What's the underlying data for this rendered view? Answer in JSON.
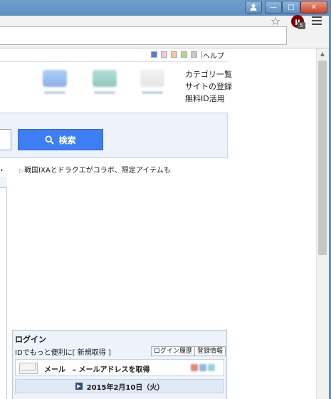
{
  "window": {
    "user_icon": "user-icon",
    "minimize_glyph": "—",
    "maximize_glyph": "□",
    "close_glyph": "✕"
  },
  "toolbar": {
    "bookmark_icon": "☆",
    "extension_label": "μ",
    "extension_badge": "5"
  },
  "header": {
    "color_swatches": [
      "#4a7fd6",
      "#f3c6de",
      "#f7c78e",
      "#a9dd8a",
      "#c9c9c9"
    ],
    "help_link": "ヘルプ",
    "side_links": [
      "カテゴリ一覧",
      "サイトの登録",
      "無料ID活用"
    ]
  },
  "search": {
    "button_label": "検索",
    "icon": "search-icon"
  },
  "news": {
    "headline": "戦国IXAとドラクエがコラボ、限定アイテムも"
  },
  "login": {
    "title": "ログイン",
    "description": "IDでもっと便利に[",
    "signup_link": "新規取得",
    "description_end": "]",
    "history_button": "ログイン履歴",
    "register_button": "登録情報",
    "mail_label": "メール　– メールアドレスを取得",
    "date": "2015年2月10日（火）"
  }
}
